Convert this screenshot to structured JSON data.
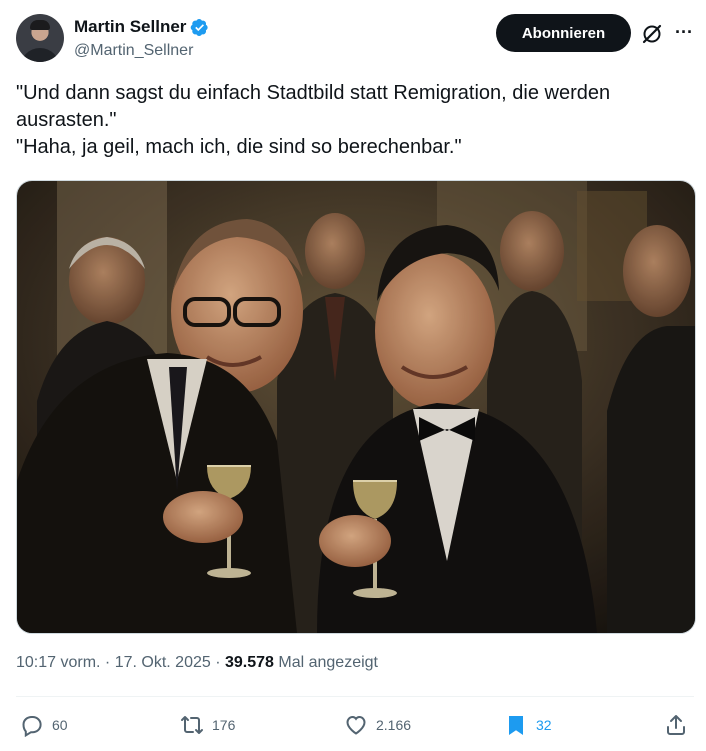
{
  "author": {
    "name": "Martin Sellner",
    "handle": "@Martin_Sellner",
    "verified": true
  },
  "header": {
    "subscribe_label": "Abonnieren",
    "grok_icon": "grok-icon",
    "more_icon": "more-icon"
  },
  "tweet": {
    "text": "\"Und dann sagst du einfach Stadtbild statt Remigration, die werden ausrasten.\"\n\"Haha, ja geil, mach ich, die sind so berechenbar.\"",
    "image_alt": ""
  },
  "meta": {
    "time": "10:17 vorm.",
    "separator1": " · ",
    "date": "17. Okt. 2025",
    "separator2": " · ",
    "views": "39.578",
    "views_label": " Mal angezeigt"
  },
  "actions": {
    "replies": "60",
    "reposts": "176",
    "likes": "2.166",
    "bookmarks": "32"
  },
  "colors": {
    "accent": "#1d9bf0",
    "text": "#0f1419",
    "secondary": "#536471"
  }
}
